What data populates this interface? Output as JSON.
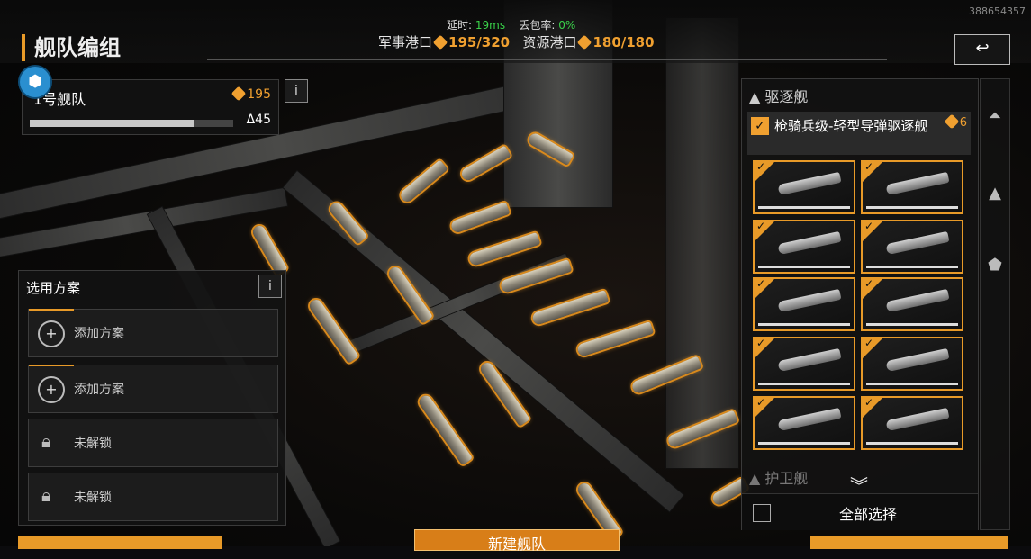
{
  "topbar": {
    "title": "舰队编组",
    "latency_label": "延时:",
    "latency_value": "19ms",
    "packet_loss_label": "丢包率:",
    "packet_loss_value": "0%",
    "military_port_label": "军事港口",
    "military_port_value": "195/320",
    "resource_port_label": "资源港口",
    "resource_port_value": "180/180",
    "user_id": "388654357",
    "back_label": "↩"
  },
  "fleet": {
    "name": "1号舰队",
    "cost": "195",
    "delta": "Δ45",
    "capacity_fraction": 0.81,
    "info_label": "i"
  },
  "plans": {
    "title": "选用方案",
    "info_label": "i",
    "slots": [
      {
        "label": "添加方案",
        "type": "add"
      },
      {
        "label": "添加方案",
        "type": "add"
      },
      {
        "label": "未解锁",
        "type": "locked"
      },
      {
        "label": "未解锁",
        "type": "locked"
      }
    ]
  },
  "roster": {
    "category_destroyer": "驱逐舰",
    "category_escort": "护卫舰",
    "ship_name": "枪骑兵级-轻型导弹驱逐舰",
    "ship_cost": "6",
    "select_all": "全部选择"
  },
  "bottom": {
    "middle_label": "新建舰队"
  },
  "colors": {
    "accent": "#e89a28",
    "latency_green": "#3ad24a",
    "gear_blue": "#2a8fd0"
  },
  "icons": [
    "gear-icon",
    "coin-icon",
    "info-icon",
    "back-arrow-icon",
    "plus-crosshair-icon",
    "padlock-icon",
    "checkmark-icon",
    "chevron-down-icon"
  ]
}
